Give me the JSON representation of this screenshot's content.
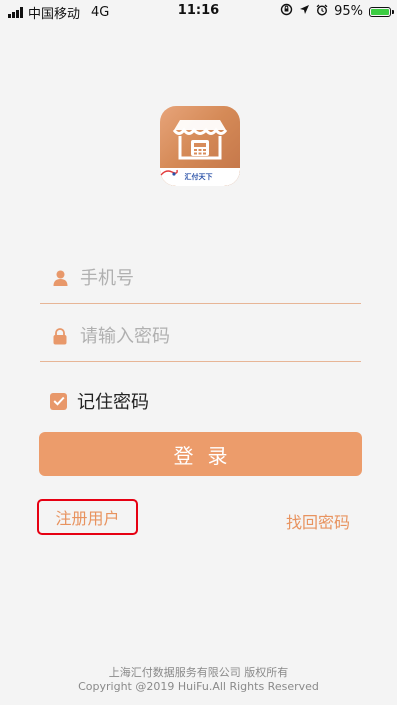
{
  "status_bar": {
    "carrier": "中国移动",
    "network": "4G",
    "time": "11:16",
    "battery_percent": "95%",
    "battery_level": 0.95,
    "battery_color": "#3ccd42",
    "icons": [
      "signal-icon",
      "orientation-lock-icon",
      "location-arrow-icon",
      "alarm-icon",
      "battery-icon"
    ]
  },
  "app_logo": {
    "brand_text": "汇付天下"
  },
  "login_form": {
    "phone_placeholder": "手机号",
    "password_placeholder": "请输入密码",
    "remember_label": "记住密码",
    "remember_checked": true,
    "login_label": "登录"
  },
  "links": {
    "register_label": "注册用户",
    "forgot_label": "找回密码"
  },
  "footer": {
    "company": "上海汇付数据服务有限公司 版权所有",
    "copyright": "Copyright @2019 HuiFu.All Rights Reserved"
  },
  "colors": {
    "accent": "#ec9c6b",
    "highlight_box": "#e60012",
    "background": "#f4f4f4"
  }
}
